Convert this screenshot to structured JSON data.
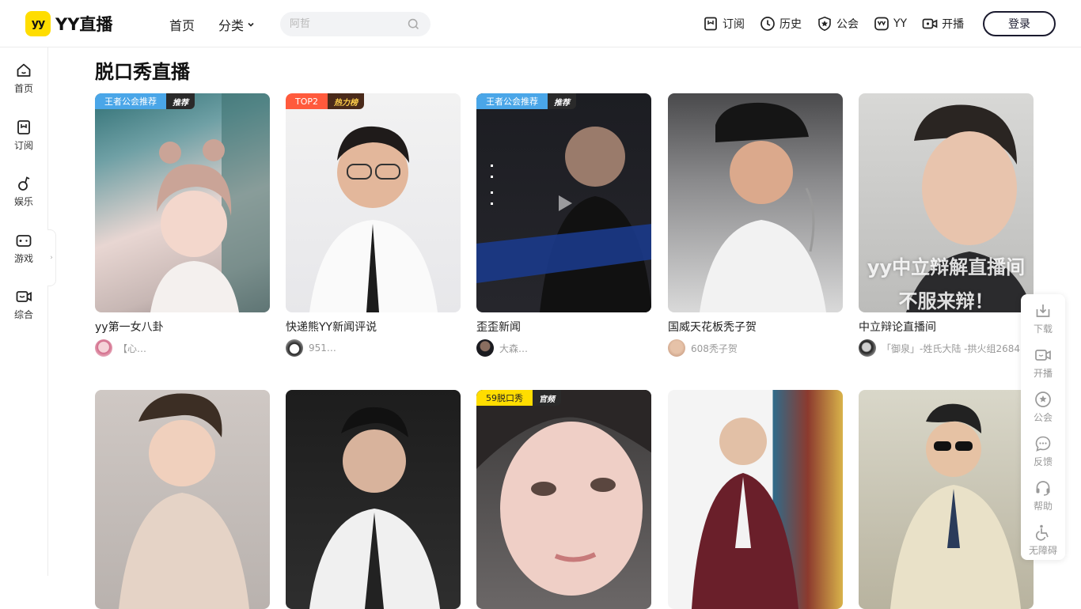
{
  "header": {
    "logo_badge": "yy",
    "logo_text": "YY直播",
    "nav_home": "首页",
    "nav_category": "分类",
    "search_placeholder": "阿哲",
    "actions": [
      {
        "label": "订阅",
        "icon": "bookmark-icon"
      },
      {
        "label": "历史",
        "icon": "clock-icon"
      },
      {
        "label": "公会",
        "icon": "star-badge-icon"
      },
      {
        "label": "YY",
        "icon": "yy-icon"
      },
      {
        "label": "开播",
        "icon": "camera-icon"
      }
    ],
    "login": "登录"
  },
  "sidebar": {
    "items": [
      {
        "label": "首页",
        "icon": "home-icon"
      },
      {
        "label": "订阅",
        "icon": "bookmark-icon"
      },
      {
        "label": "娱乐",
        "icon": "music-note-icon"
      },
      {
        "label": "游戏",
        "icon": "gamepad-icon"
      },
      {
        "label": "综合",
        "icon": "video-camera-icon"
      }
    ],
    "toggle": "›"
  },
  "section": {
    "title": "脱口秀直播"
  },
  "cards": [
    {
      "title": "yy第一女八卦",
      "anchor": "【心…",
      "tag": "王者公会推荐",
      "tag2": "推荐",
      "tag_style": "blue",
      "overlay": ""
    },
    {
      "title": "快递熊YY新闻评说",
      "anchor": "951…",
      "tag": "TOP2",
      "tag2": "热力榜",
      "tag_style": "red",
      "overlay": ""
    },
    {
      "title": "歪歪新闻",
      "anchor": "大森…",
      "tag": "王者公会推荐",
      "tag2": "推荐",
      "tag_style": "blue",
      "overlay": ""
    },
    {
      "title": "国威天花板秃子贺",
      "anchor": "608秃子贺",
      "tag": "",
      "tag2": "",
      "tag_style": "",
      "overlay": ""
    },
    {
      "title": "中立辩论直播间",
      "anchor": "「御泉」-姓氏大陆 -拱火组2684",
      "tag": "",
      "tag2": "",
      "tag_style": "",
      "overlay": "yy中立辩解直播间",
      "overlay2": "不服来辩！"
    },
    {
      "title": "",
      "anchor": "",
      "tag": "",
      "tag2": "",
      "tag_style": "",
      "overlay": ""
    },
    {
      "title": "",
      "anchor": "",
      "tag": "",
      "tag2": "",
      "tag_style": "",
      "overlay": ""
    },
    {
      "title": "",
      "anchor": "",
      "tag": "59脱口秀",
      "tag2": "官频",
      "tag_style": "yellow",
      "overlay": ""
    },
    {
      "title": "",
      "anchor": "",
      "tag": "",
      "tag2": "",
      "tag_style": "",
      "overlay": ""
    },
    {
      "title": "",
      "anchor": "",
      "tag": "",
      "tag2": "",
      "tag_style": "",
      "overlay": ""
    }
  ],
  "float_bar": {
    "items": [
      {
        "label": "下载",
        "icon": "download-icon"
      },
      {
        "label": "开播",
        "icon": "camera-icon"
      },
      {
        "label": "公会",
        "icon": "star-badge-icon"
      },
      {
        "label": "反馈",
        "icon": "chat-icon"
      },
      {
        "label": "帮助",
        "icon": "headset-icon"
      },
      {
        "label": "无障碍",
        "icon": "accessibility-icon"
      }
    ]
  },
  "colors": {
    "brand_yellow": "#ffdd00",
    "login_border": "#1a1a2e",
    "tag_blue": "#4aa6e8",
    "tag_red": "#ff5a3c"
  }
}
